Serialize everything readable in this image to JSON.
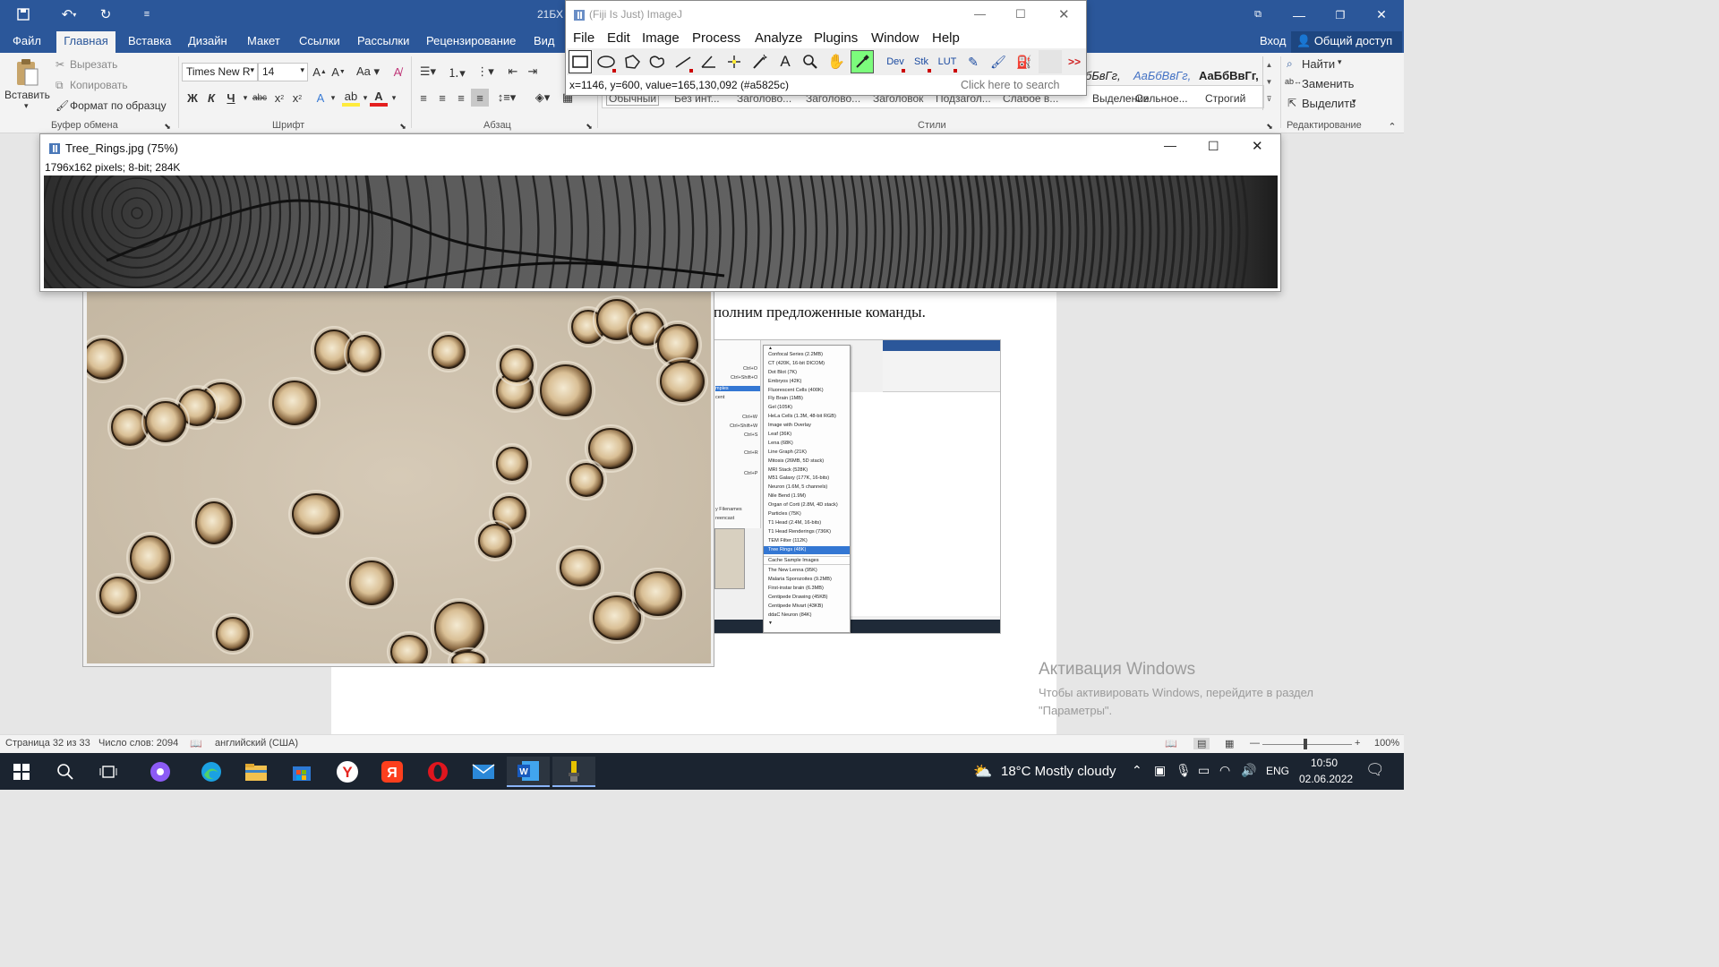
{
  "word": {
    "doc_title": "21БХ",
    "tabs": [
      "Файл",
      "Главная",
      "Вставка",
      "Дизайн",
      "Макет",
      "Ссылки",
      "Рассылки",
      "Рецензирование",
      "Вид"
    ],
    "login": "Вход",
    "share": "Общий доступ",
    "clipboard": {
      "paste": "Вставить",
      "cut": "Вырезать",
      "copy": "Копировать",
      "format_painter": "Формат по образцу",
      "group": "Буфер обмена"
    },
    "font": {
      "name": "Times New R",
      "size": "14",
      "group": "Шрифт"
    },
    "paragraph": {
      "group": "Абзац"
    },
    "styles": {
      "group": "Стили",
      "items": [
        {
          "sample": "бБвГг,",
          "caption": "Выделение"
        },
        {
          "sample": "АаБбВвГг,",
          "caption": "Сильное..."
        },
        {
          "sample": "АаБбВвГг,",
          "caption": "Строгий"
        }
      ],
      "hidden_captions": [
        "Обычный",
        "Без инт...",
        "Заголово...",
        "Заголово...",
        "Заголовок",
        "Подзагол...",
        "Слабое в..."
      ]
    },
    "editing": {
      "find": "Найти",
      "replace": "Заменить",
      "select": "Выделить",
      "group": "Редактирование"
    },
    "doc_text": "полним предложенные команды.",
    "activation_title": "Активация Windows",
    "activation_sub": "Чтобы активировать Windows, перейдите в раздел \"Параметры\".",
    "status": {
      "page": "Страница 32 из 33",
      "words": "Число слов: 2094",
      "lang": "английский (США)",
      "zoom": "100%"
    }
  },
  "fiji": {
    "title": "(Fiji Is Just) ImageJ",
    "menu": [
      "File",
      "Edit",
      "Image",
      "Process",
      "Analyze",
      "Plugins",
      "Window",
      "Help"
    ],
    "status": "x=1146, y=600, value=165,130,092 (#a5825c)",
    "search_placeholder": "Click here to search",
    "tools": [
      "rectangle-tool",
      "oval-tool",
      "polygon-tool",
      "freehand-tool",
      "line-tool",
      "angle-tool",
      "point-tool",
      "wand-tool",
      "text-tool",
      "magnifier-tool",
      "hand-tool",
      "color-picker-tool",
      "dev-menu",
      "stk-menu",
      "lut-menu",
      "pencil-tool",
      "brush-tool",
      "flood-fill-tool",
      "blank-slot",
      "more-tools"
    ],
    "tool_text": {
      "dev": "Dev",
      "stk": "Stk",
      "lut": "LUT",
      "more": ">>"
    }
  },
  "tree_window": {
    "title": "Tree_Rings.jpg (75%)",
    "info": "1796x162 pixels; 8-bit; 284K"
  },
  "embedded": {
    "menu_items": [
      "Confocal Series (2.2MB)",
      "CT (420K, 16-bit DICOM)",
      "Dot Blot (7K)",
      "Embryos (42K)",
      "Fluorescent Cells (400K)",
      "Fly Brain (1MB)",
      "Gel (105K)",
      "HeLa Cells (1.3M, 48-bit RGB)",
      "Image with Overlay",
      "Leaf (36K)",
      "Lena (68K)",
      "Line Graph (21K)",
      "Mitosis (26MB, 5D stack)",
      "MRI Stack (528K)",
      "M51 Galaxy (177K, 16-bits)",
      "Neuron (1.6M, 5 channels)",
      "Nile Bend (1.9M)",
      "Organ of Corti (2.8M, 4D stack)",
      "Particles (75K)",
      "T1 Head (2.4M, 16-bits)",
      "T1 Head Renderings (736K)",
      "TEM Filter (112K)",
      "Tree Rings (48K)",
      "Cache Sample Images",
      "The New Lenna (95K)",
      "Malaria Sporozoites (9.2MB)",
      "First-instar brain (6.3MB)",
      "Centipede Drawing (45KB)",
      "Centipede Mivart (43KB)",
      "ddaC Neuron (84K)"
    ],
    "selected_index": 22,
    "side_texts": [
      "Ctrl+O",
      "Ctrl+Shift+O",
      "mples",
      "cent",
      "Ctrl+W",
      "Ctrl+Shift+W",
      "Ctrl+S",
      "Ctrl+R",
      "Ctrl+P",
      "y Filenames",
      "reencast"
    ]
  },
  "taskbar": {
    "weather": "18°C  Mostly cloudy",
    "lang": "ENG",
    "time": "10:50",
    "date": "02.06.2022"
  },
  "colors": {
    "word_blue": "#2b579a",
    "taskbar": "#1b2430",
    "fiji_status_value": "#a5825c"
  }
}
